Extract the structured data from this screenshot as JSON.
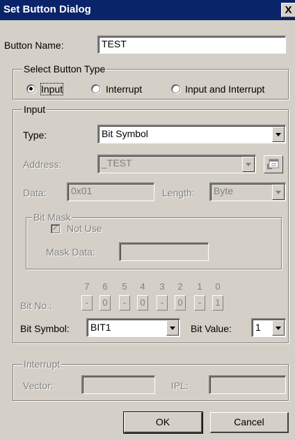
{
  "dialog": {
    "title": "Set Button Dialog",
    "close_glyph": "X"
  },
  "button_name": {
    "label": "Button Name:",
    "value": "TEST"
  },
  "button_type": {
    "title": "Select Button Type",
    "options": [
      {
        "label": "Input",
        "selected": true
      },
      {
        "label": "Interrupt",
        "selected": false
      },
      {
        "label": "Input and Interrupt",
        "selected": false
      }
    ]
  },
  "input_group": {
    "title": "Input",
    "type_label": "Type:",
    "type_value": "Bit Symbol",
    "address_label": "Address:",
    "address_value": "_TEST",
    "data_label": "Data:",
    "data_value": "0x01",
    "length_label": "Length:",
    "length_value": "Byte",
    "bit_mask": {
      "title": "Bit Mask",
      "not_use_label": "Not Use",
      "not_use_checked": true,
      "mask_data_label": "Mask Data:",
      "mask_data_value": ""
    },
    "bit_no_label": "Bit No.:",
    "bit_numbers": [
      "7",
      "6",
      "5",
      "4",
      "3",
      "2",
      "1",
      "0"
    ],
    "bit_values": [
      "-",
      "0",
      "-",
      "0",
      "-",
      "0",
      "-",
      "1"
    ],
    "bit_symbol_label": "Bit Symbol:",
    "bit_symbol_value": "BIT1",
    "bit_value_label": "Bit Value:",
    "bit_value": "1"
  },
  "interrupt_group": {
    "title": "Interrupt",
    "vector_label": "Vector:",
    "vector_value": "",
    "ipl_label": "IPL:",
    "ipl_value": ""
  },
  "footer": {
    "ok_label": "OK",
    "cancel_label": "Cancel"
  },
  "icons": {
    "address_browse": "browse-icon"
  },
  "colors": {
    "titlebar": "#0a246a",
    "face": "#d4d0c8",
    "disabled_text": "#808080"
  }
}
